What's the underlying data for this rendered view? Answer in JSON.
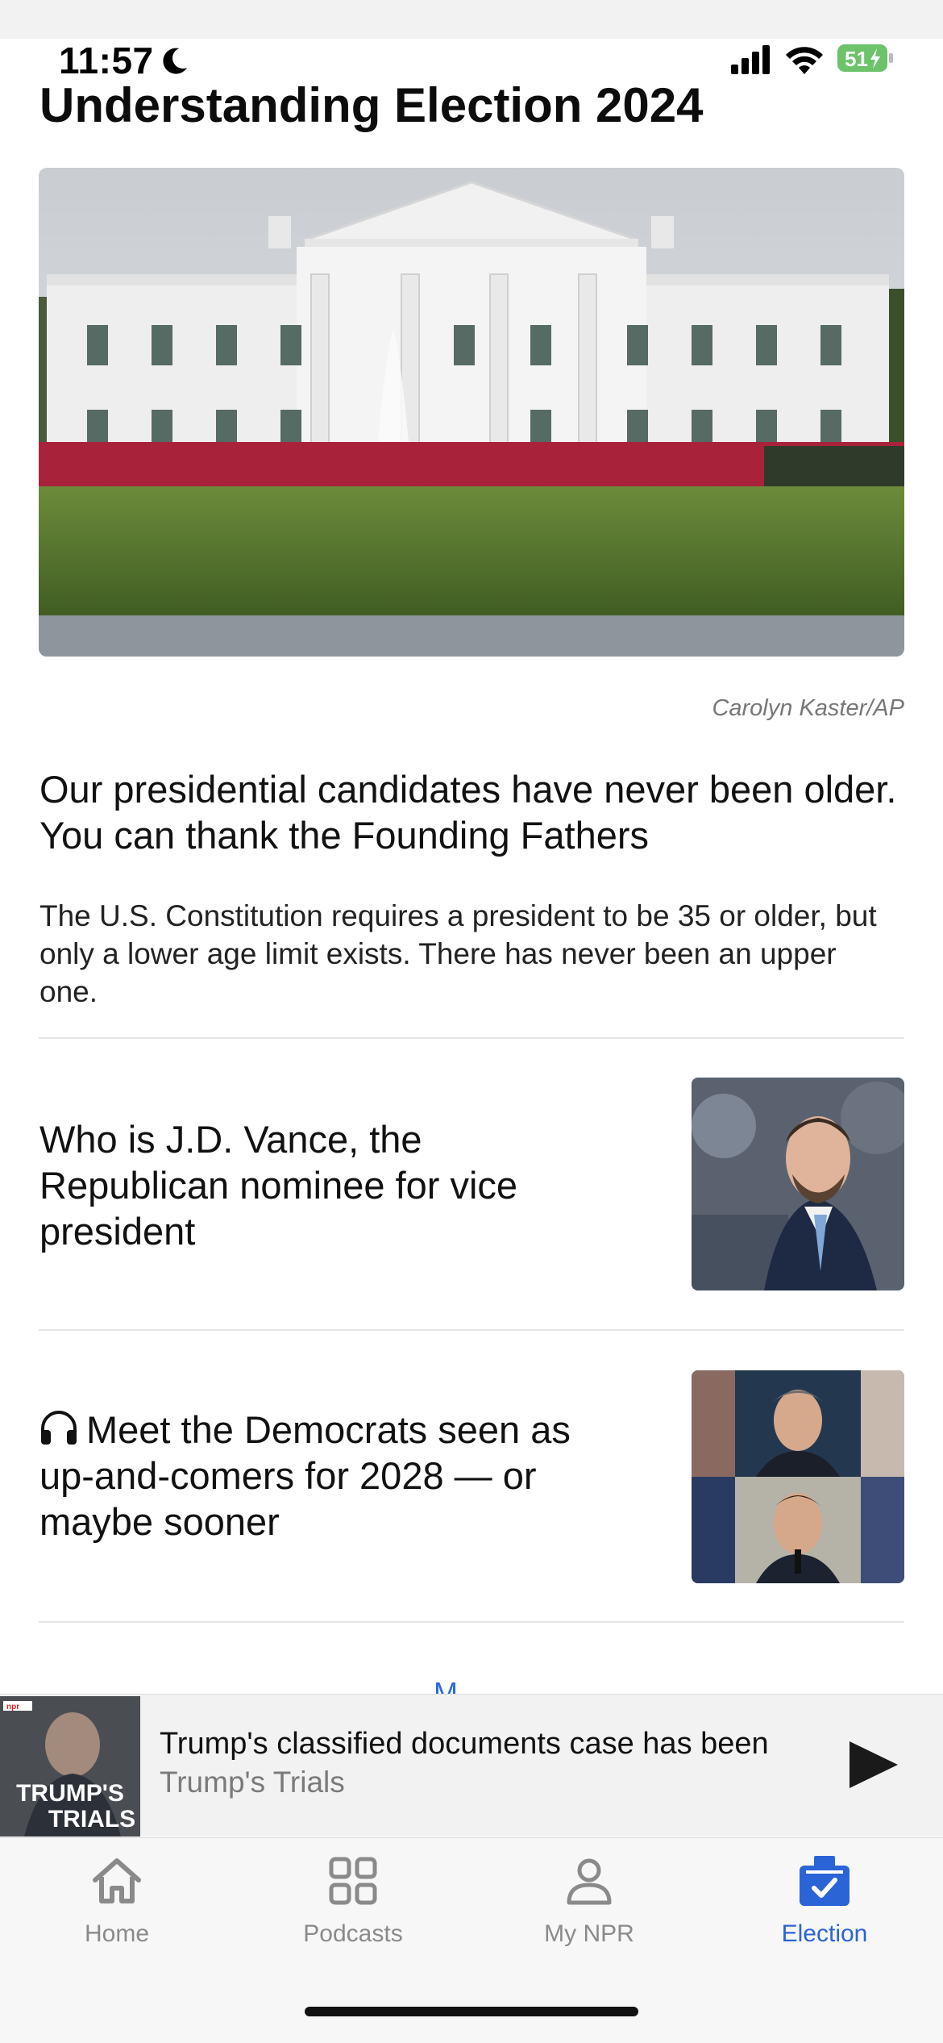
{
  "status_bar": {
    "time": "11:57",
    "battery": "51"
  },
  "section": {
    "title": "Understanding Election 2024"
  },
  "hero": {
    "photo_credit": "Carolyn Kaster/AP"
  },
  "lead_story": {
    "headline": "Our presidential candidates have never been older. You can thank the Founding Fathers",
    "summary": "The U.S. Constitution requires a president to be 35 or older, but only a lower age limit exists. There has never been an upper one."
  },
  "stories": [
    {
      "title": "Who is J.D. Vance, the Republican nominee for vice president",
      "audio": false
    },
    {
      "title": "Meet the Democrats seen as up-and-comers for 2028 — or maybe sooner",
      "audio": true
    }
  ],
  "more_link": "M",
  "now_playing": {
    "title": "Trump's classified documents case has been",
    "show": "Trump's Trials",
    "art_logo": "npr",
    "art_text_line1": "TRUMP'S",
    "art_text_line2": "TRIALS"
  },
  "tab_bar": {
    "tabs": [
      {
        "label": "Home",
        "icon": "home-icon",
        "active": false
      },
      {
        "label": "Podcasts",
        "icon": "grid-icon",
        "active": false
      },
      {
        "label": "My NPR",
        "icon": "person-icon",
        "active": false
      },
      {
        "label": "Election",
        "icon": "ballot-box-icon",
        "active": true
      }
    ]
  },
  "colors": {
    "accent": "#2a64d6",
    "battery_green": "#6cc36a",
    "inactive_tab": "#8a8a8a"
  }
}
